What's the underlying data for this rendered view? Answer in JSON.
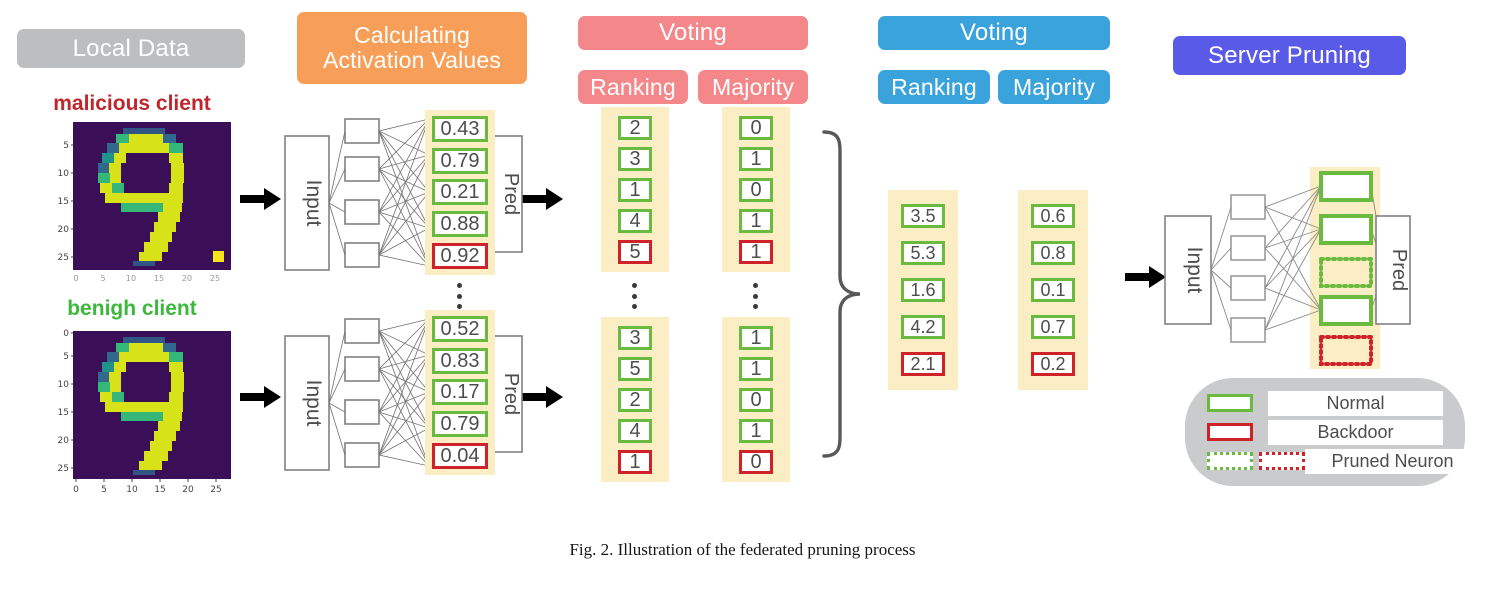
{
  "figure": {
    "caption": "Fig. 2.  Illustration of the federated pruning process"
  },
  "colors": {
    "gray": "#bcbec0",
    "orange": "#f79f58",
    "red": "#f4878a",
    "blue": "#3ba3dc",
    "purple": "#5a5ae8",
    "normal_border": "#6aba3f",
    "backdoor_border": "#cf2128",
    "highlight_band": "#fbeec4",
    "malicious_label": "#c0272d",
    "benign_label": "#3db83d",
    "legend_bg": "#c9cbcd"
  },
  "stages": {
    "local_data": "Local Data",
    "calculating": "Calculating\nActivation Values",
    "client_voting": "Voting",
    "client_ranking": "Ranking",
    "client_majority": "Majority",
    "server_voting": "Voting",
    "server_ranking": "Ranking",
    "server_majority": "Majority",
    "server_pruning": "Server Pruning"
  },
  "clients": [
    {
      "label": "malicious client",
      "kind": "malicious",
      "digit": "9",
      "has_trigger": true,
      "xticks": [
        "0",
        "5",
        "10",
        "15",
        "20",
        "25"
      ],
      "yticks": [
        "5",
        "10",
        "15",
        "20",
        "25"
      ],
      "net": {
        "input_label": "Input",
        "pred_label": "Pred"
      },
      "activations": [
        {
          "value": "0.43",
          "status": "normal"
        },
        {
          "value": "0.79",
          "status": "normal"
        },
        {
          "value": "0.21",
          "status": "normal"
        },
        {
          "value": "0.88",
          "status": "normal"
        },
        {
          "value": "0.92",
          "status": "backdoor"
        }
      ],
      "ranking": [
        {
          "value": "2",
          "status": "normal"
        },
        {
          "value": "3",
          "status": "normal"
        },
        {
          "value": "1",
          "status": "normal"
        },
        {
          "value": "4",
          "status": "normal"
        },
        {
          "value": "5",
          "status": "backdoor"
        }
      ],
      "majority": [
        {
          "value": "0",
          "status": "normal"
        },
        {
          "value": "1",
          "status": "normal"
        },
        {
          "value": "0",
          "status": "normal"
        },
        {
          "value": "1",
          "status": "normal"
        },
        {
          "value": "1",
          "status": "backdoor"
        }
      ]
    },
    {
      "label": "benigh client",
      "kind": "benign",
      "digit": "9",
      "has_trigger": false,
      "xticks": [
        "0",
        "5",
        "10",
        "15",
        "20",
        "25"
      ],
      "yticks": [
        "0",
        "5",
        "10",
        "15",
        "20",
        "25"
      ],
      "net": {
        "input_label": "Input",
        "pred_label": "Pred"
      },
      "activations": [
        {
          "value": "0.52",
          "status": "normal"
        },
        {
          "value": "0.83",
          "status": "normal"
        },
        {
          "value": "0.17",
          "status": "normal"
        },
        {
          "value": "0.79",
          "status": "normal"
        },
        {
          "value": "0.04",
          "status": "backdoor"
        }
      ],
      "ranking": [
        {
          "value": "3",
          "status": "normal"
        },
        {
          "value": "5",
          "status": "normal"
        },
        {
          "value": "2",
          "status": "normal"
        },
        {
          "value": "4",
          "status": "normal"
        },
        {
          "value": "1",
          "status": "backdoor"
        }
      ],
      "majority": [
        {
          "value": "1",
          "status": "normal"
        },
        {
          "value": "1",
          "status": "normal"
        },
        {
          "value": "0",
          "status": "normal"
        },
        {
          "value": "1",
          "status": "normal"
        },
        {
          "value": "0",
          "status": "backdoor"
        }
      ]
    }
  ],
  "server": {
    "ranking": [
      {
        "value": "3.5",
        "status": "normal"
      },
      {
        "value": "5.3",
        "status": "normal"
      },
      {
        "value": "1.6",
        "status": "normal"
      },
      {
        "value": "4.2",
        "status": "normal"
      },
      {
        "value": "2.1",
        "status": "backdoor"
      }
    ],
    "majority": [
      {
        "value": "0.6",
        "status": "normal"
      },
      {
        "value": "0.8",
        "status": "normal"
      },
      {
        "value": "0.1",
        "status": "normal"
      },
      {
        "value": "0.7",
        "status": "normal"
      },
      {
        "value": "0.2",
        "status": "backdoor"
      }
    ],
    "net": {
      "input_label": "Input",
      "pred_label": "Pred"
    },
    "neurons": [
      {
        "status": "normal"
      },
      {
        "status": "normal"
      },
      {
        "status": "pruned-normal"
      },
      {
        "status": "normal"
      },
      {
        "status": "pruned-backdoor"
      }
    ]
  },
  "legend": {
    "rows": [
      {
        "label": "Normal",
        "swatches": [
          "green-solid"
        ]
      },
      {
        "label": "Backdoor",
        "swatches": [
          "red-solid"
        ]
      },
      {
        "label": "Pruned Neuron",
        "swatches": [
          "green-dotted",
          "red-dotted"
        ]
      }
    ]
  }
}
